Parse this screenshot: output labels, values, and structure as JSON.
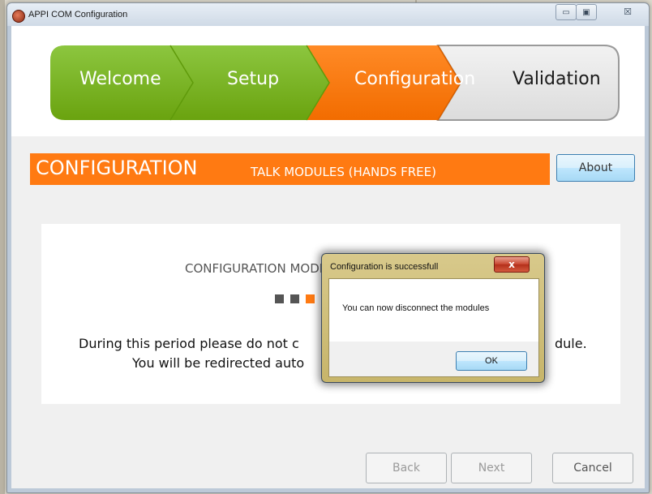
{
  "window": {
    "title": "APPI COM Configuration",
    "minimize_glyph": "▭",
    "maximize_glyph": "▣",
    "close_glyph": "☒"
  },
  "steps": [
    {
      "label": "Welcome",
      "state": "done",
      "color": "#7ab317"
    },
    {
      "label": "Setup",
      "state": "done",
      "color": "#7ab317"
    },
    {
      "label": "Configuration",
      "state": "active",
      "color": "#ff7a12"
    },
    {
      "label": "Validation",
      "state": "pending",
      "color": "#e8e8e8"
    }
  ],
  "banner": {
    "title": "CONFIGURATION",
    "subtitle": "TALK MODULES (HANDS FREE)"
  },
  "about_label": "About",
  "panel": {
    "mode_text": "CONFIGURATION MODE",
    "line1_left": "During this period please do not c",
    "line1_right": "dule.",
    "line2_left": "You will be redirected auto"
  },
  "dialog": {
    "title": "Configuration is successfull",
    "close_glyph": "x",
    "message": "You can now disconnect the modules",
    "ok_label": "OK"
  },
  "nav": {
    "back_label": "Back",
    "next_label": "Next",
    "cancel_label": "Cancel"
  },
  "colors": {
    "green": "#7ab317",
    "orange": "#ff7a12",
    "grey_step": "#e8e8e8"
  }
}
